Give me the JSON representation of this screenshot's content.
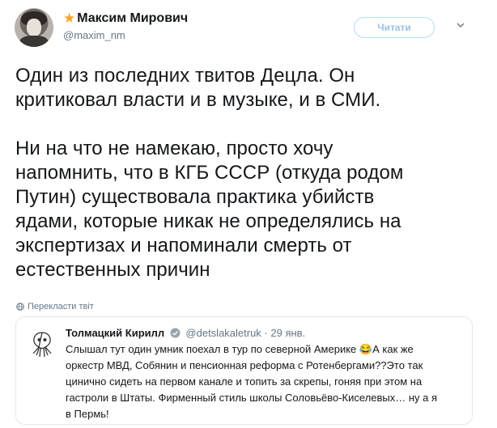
{
  "author": {
    "name": "Максим Мирович",
    "handle": "@maxim_nm",
    "badge_icon": "star-icon",
    "badge_color": "#f5a623"
  },
  "follow": {
    "label": "Читати"
  },
  "tweet": {
    "text": "Один из последних твитов Децла. Он\nкритиковал власти и в музыке, и в СМИ.\n\nНи на что не намекаю, просто хочу\nнапомнить, что в КГБ СССР (откуда родом\nПутин) существовала практика убийств\nядами, которые никак не определялись на\nэкспертизах и напоминали смерть от\nестественных причин"
  },
  "translate": {
    "label": "Перекласти твіт"
  },
  "quoted": {
    "name": "Толмацкий Кирилл",
    "verified_icon": "checkmark-icon",
    "handle": "@detslakaletruk",
    "separator": " · ",
    "date": "29 янв.",
    "text_part1": "Слышал тут один умник поехал в тур по северной Америке ",
    "emoji": "😂",
    "text_part2": "А как же\nоркестр МВД, Собянин и пенсионная реформа с Ротенбергами??Это так\nцинично сидеть на первом канале и топить за скрепы, гоняя при этом на\nгастроли в Штаты. Фирменный стиль школы Соловьёво-Киселевых… ну а я\nв Пермь!"
  },
  "colors": {
    "text": "#14171a",
    "secondary": "#657786",
    "link_blue": "#9ac4e4",
    "border": "#e1e8ed"
  }
}
